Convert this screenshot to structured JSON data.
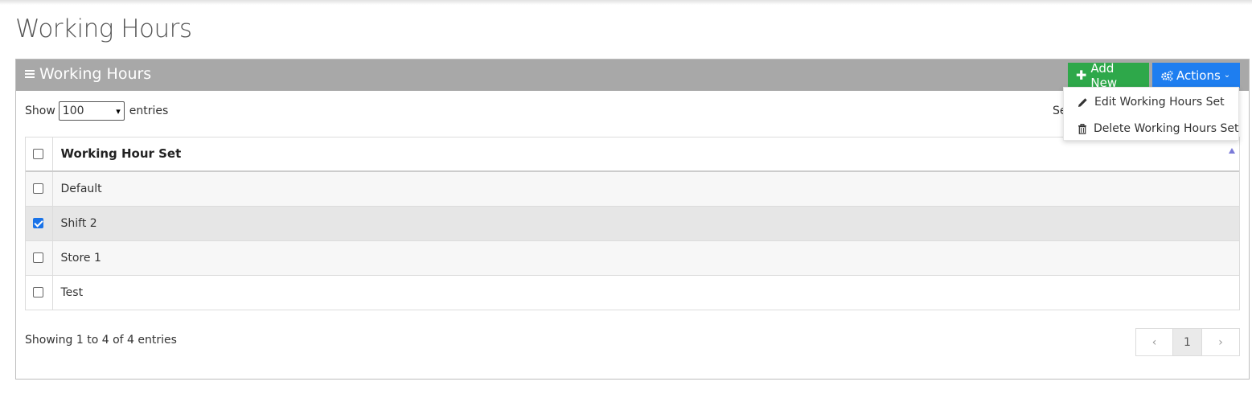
{
  "page": {
    "title": "Working Hours"
  },
  "panel": {
    "title": "Working Hours",
    "add_button": "Add New",
    "actions_button": "Actions"
  },
  "length": {
    "show_label": "Show",
    "selected": "100",
    "entries_label": "entries"
  },
  "search": {
    "label_partial": "Se"
  },
  "table": {
    "header": "Working Hour Set",
    "rows": [
      {
        "name": "Default",
        "checked": false
      },
      {
        "name": "Shift 2",
        "checked": true
      },
      {
        "name": "Store 1",
        "checked": false
      },
      {
        "name": "Test",
        "checked": false
      }
    ]
  },
  "footer": {
    "info": "Showing 1 to 4 of 4 entries"
  },
  "pagination": {
    "prev": "‹",
    "current": "1",
    "next": "›"
  },
  "actions_menu": {
    "items": [
      {
        "label": "Edit Working Hours Set",
        "icon": "pencil-icon"
      },
      {
        "label": "Delete Working Hours Set",
        "icon": "trash-icon"
      }
    ]
  },
  "colors": {
    "header_bg": "#a8a8a8",
    "add_green": "#2ea84a",
    "actions_blue": "#1e7ef0",
    "selected_row": "#e6e6e6"
  }
}
